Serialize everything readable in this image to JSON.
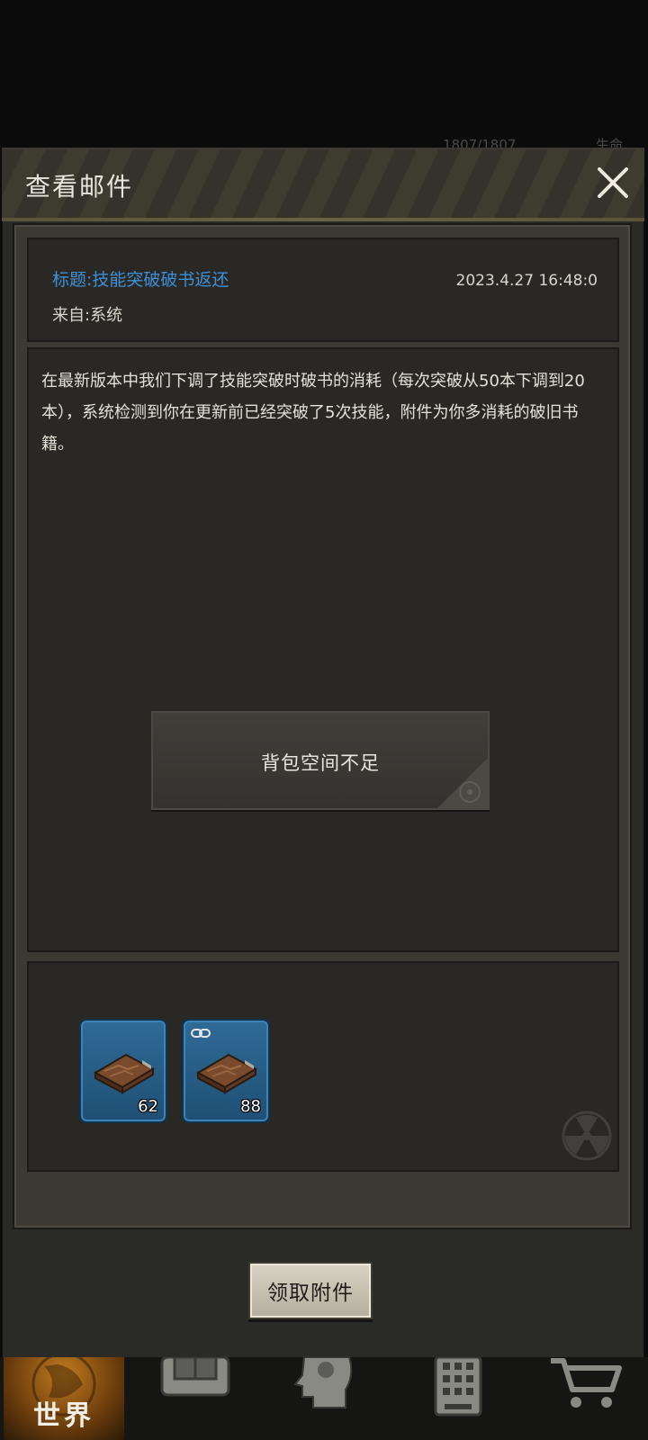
{
  "background_hud": {
    "hp": "1807/1807",
    "life": "生命"
  },
  "modal": {
    "title": "查看邮件",
    "subject": "标题:技能突破破书返还",
    "sender": "来自:系统",
    "timestamp": "2023.4.27 16:48:0",
    "body": "在最新版本中我们下调了技能突破时破书的消耗（每次突破从50本下调到20本），系统检测到你在更新前已经突破了5次技能，附件为你多消耗的破旧书籍。",
    "attachments": [
      {
        "icon": "old-book-icon",
        "count": "62",
        "bound": false
      },
      {
        "icon": "old-book-icon",
        "count": "88",
        "bound": true
      }
    ],
    "claim_label": "领取附件"
  },
  "toast": {
    "message": "背包空间不足"
  },
  "bottom_nav": {
    "items": [
      {
        "label": "世界",
        "icon": "globe-icon",
        "active": true
      },
      {
        "icon": "backpack-icon"
      },
      {
        "icon": "head-gear-icon"
      },
      {
        "icon": "calculator-icon"
      },
      {
        "icon": "cart-icon"
      }
    ]
  },
  "colors": {
    "subject_blue": "#3d8fd6",
    "slot_blue": "#2f6b97",
    "world_orange": "#c07a1e"
  }
}
